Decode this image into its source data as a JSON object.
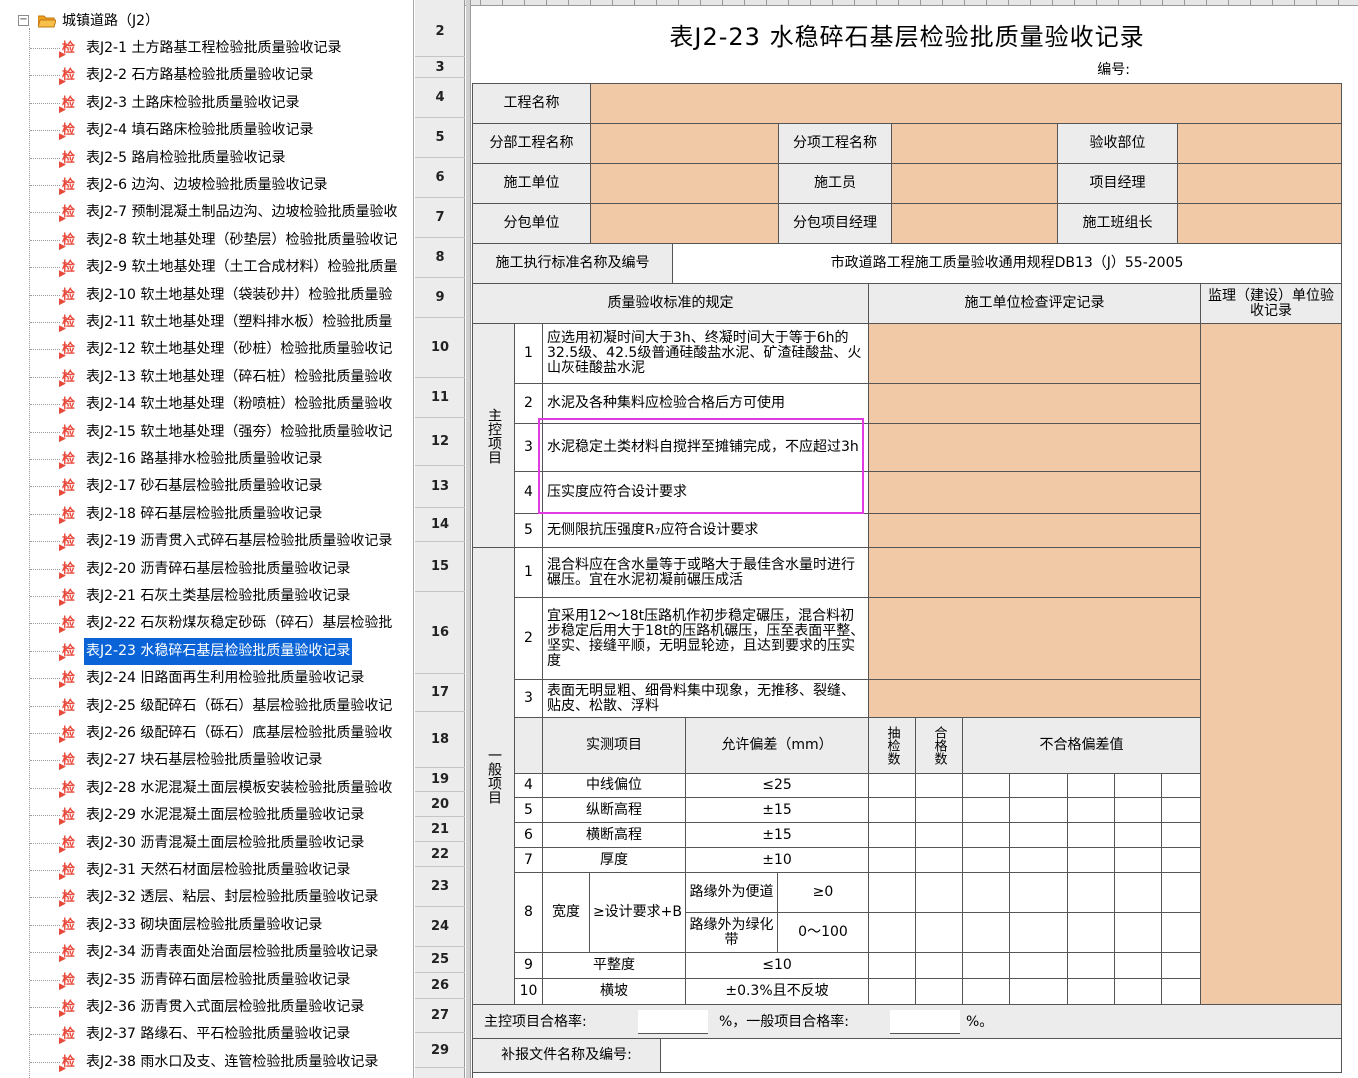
{
  "tree": {
    "root_label": "城镇道路（J2）",
    "expander": "−",
    "node_icon": "检",
    "items": [
      "表J2-1 土方路基工程检验批质量验收记录",
      "表J2-2 石方路基检验批质量验收记录",
      "表J2-3 土路床检验批质量验收记录",
      "表J2-4 填石路床检验批质量验收记录",
      "表J2-5 路肩检验批质量验收记录",
      "表J2-6 边沟、边坡检验批质量验收记录",
      "表J2-7 预制混凝土制品边沟、边坡检验批质量验收",
      "表J2-8 软土地基处理（砂垫层）检验批质量验收记",
      "表J2-9 软土地基处理（土工合成材料）检验批质量",
      "表J2-10 软土地基处理（袋装砂井）检验批质量验",
      "表J2-11 软土地基处理（塑料排水板）检验批质量",
      "表J2-12 软土地基处理（砂桩）检验批质量验收记",
      "表J2-13 软土地基处理（碎石桩）检验批质量验收",
      "表J2-14 软土地基处理（粉喷桩）检验批质量验收",
      "表J2-15 软土地基处理（强夯）检验批质量验收记",
      "表J2-16 路基排水检验批质量验收记录",
      "表J2-17 砂石基层检验批质量验收记录",
      "表J2-18 碎石基层检验批质量验收记录",
      "表J2-19 沥青贯入式碎石基层检验批质量验收记录",
      "表J2-20 沥青碎石基层检验批质量验收记录",
      "表J2-21 石灰土类基层检验批质量验收记录",
      "表J2-22 石灰粉煤灰稳定砂砾（碎石）基层检验批",
      "表J2-23 水稳碎石基层检验批质量验收记录",
      "表J2-24 旧路面再生利用检验批质量验收记录",
      "表J2-25 级配碎石（砾石）基层检验批质量验收记",
      "表J2-26 级配碎石（砾石）底基层检验批质量验收",
      "表J2-27 块石基层检验批质量验收记录",
      "表J2-28 水泥混凝土面层模板安装检验批质量验收",
      "表J2-29 水泥混凝土面层检验批质量验收记录",
      "表J2-30 沥青混凝土面层检验批质量验收记录",
      "表J2-31 天然石材面层检验批质量验收记录",
      "表J2-32 透层、粘层、封层检验批质量验收记录",
      "表J2-33 砌块面层检验批质量验收记录",
      "表J2-34 沥青表面处治面层检验批质量验收记录",
      "表J2-35 沥青碎石面层检验批质量验收记录",
      "表J2-36 沥青贯入式面层检验批质量验收记录",
      "表J2-37 路缘石、平石检验批质量验收记录",
      "表J2-38 雨水口及支、连管检验批质量验收记录"
    ],
    "selected_index": 22
  },
  "rows": [
    "2",
    "3",
    "4",
    "5",
    "6",
    "7",
    "8",
    "9",
    "10",
    "11",
    "12",
    "13",
    "14",
    "15",
    "16",
    "17",
    "18",
    "19",
    "20",
    "21",
    "22",
    "23",
    "24",
    "25",
    "26",
    "27",
    "29"
  ],
  "form": {
    "title": "表J2-23  水稳碎石基层检验批质量验收记录",
    "number_label": "编号:",
    "project_name_label": "工程名称",
    "sub_project_label": "分部工程名称",
    "item_project_label": "分项工程名称",
    "acceptance_part_label": "验收部位",
    "construction_unit_label": "施工单位",
    "constructor_label": "施工员",
    "project_manager_label": "项目经理",
    "subcontract_unit_label": "分包单位",
    "subcontract_manager_label": "分包项目经理",
    "team_leader_label": "施工班组长",
    "standard_label": "施工执行标准名称及编号",
    "standard_value": "市政道路工程施工质量验收通用规程DB13（J）55-2005",
    "hdr_spec": "质量验收标准的规定",
    "hdr_check": "施工单位检查评定记录",
    "hdr_supervision": "监理（建设）单位验收记录",
    "main_items_label": "主控项目",
    "main_items": [
      {
        "no": "1",
        "text": "应选用初凝时间大于3h、终凝时间大于等于6h的32.5级、42.5级普通硅酸盐水泥、矿渣硅酸盐、火山灰硅酸盐水泥"
      },
      {
        "no": "2",
        "text": "水泥及各种集料应检验合格后方可使用"
      },
      {
        "no": "3",
        "text": "水泥稳定土类材料自搅拌至摊铺完成，不应超过3h"
      },
      {
        "no": "4",
        "text": "压实度应符合设计要求"
      },
      {
        "no": "5",
        "text": "无侧限抗压强度R₇应符合设计要求"
      }
    ],
    "general_items_label": "一般项目",
    "general_items": [
      {
        "no": "1",
        "text": "混合料应在含水量等于或略大于最佳含水量时进行碾压。宜在水泥初凝前碾压成活"
      },
      {
        "no": "2",
        "text": "宜采用12～18t压路机作初步稳定碾压，混合料初步稳定后用大于18t的压路机碾压，压至表面平整、坚实、接缝平顺，无明显轮迹，且达到要求的压实度"
      },
      {
        "no": "3",
        "text": "表面无明显粗、细骨料集中现象，无推移、裂缝、贴皮、松散、浮料"
      }
    ],
    "measure_hdr": {
      "item": "实测项目",
      "tolerance": "允许偏差（mm）",
      "sample": "抽检数",
      "pass": "合格数",
      "fail": "不合格偏差值"
    },
    "measures": [
      {
        "no": "4",
        "item": "中线偏位",
        "tolerance": "≤25"
      },
      {
        "no": "5",
        "item": "纵断高程",
        "tolerance": "±15"
      },
      {
        "no": "6",
        "item": "横断高程",
        "tolerance": "±15"
      },
      {
        "no": "7",
        "item": "厚度",
        "tolerance": "±10"
      }
    ],
    "width": {
      "no": "8",
      "label": "宽度",
      "req": "≥设计要求+B",
      "sub1_label": "路缘外为便道",
      "sub1_val": "≥0",
      "sub2_label": "路缘外为绿化带",
      "sub2_val": "0～100"
    },
    "measures2": [
      {
        "no": "9",
        "item": "平整度",
        "tolerance": "≤10"
      },
      {
        "no": "10",
        "item": "横坡",
        "tolerance": "±0.3%且不反坡"
      }
    ],
    "pass_rate_label": "主控项目合格率:",
    "pass_rate_mid": "%，一般项目合格率:",
    "pass_rate_end": "%。",
    "supplement_label": "补报文件名称及编号:"
  }
}
